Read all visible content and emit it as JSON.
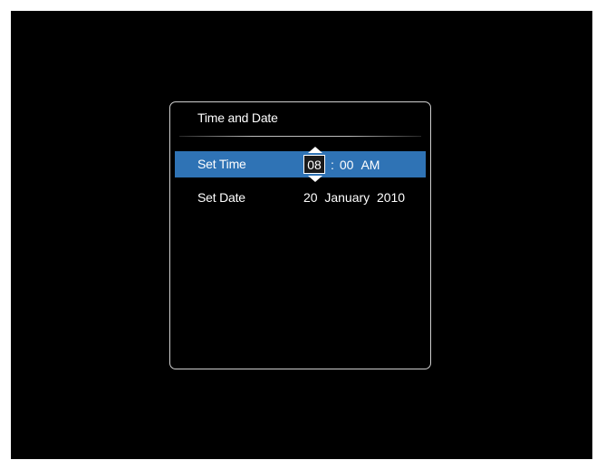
{
  "dialog": {
    "title": "Time and Date"
  },
  "rows": {
    "time": {
      "label": "Set Time",
      "hour": "08",
      "separator": ":",
      "minute": "00",
      "meridiem": "AM"
    },
    "date": {
      "label": "Set Date",
      "value": "20  January  2010"
    }
  },
  "icons": {
    "increment": "triangle-up-icon",
    "decrement": "triangle-down-icon"
  },
  "colors": {
    "background": "#000000",
    "selection": "#2f73b5",
    "text": "#ffffff",
    "border": "#cfcfcf"
  }
}
